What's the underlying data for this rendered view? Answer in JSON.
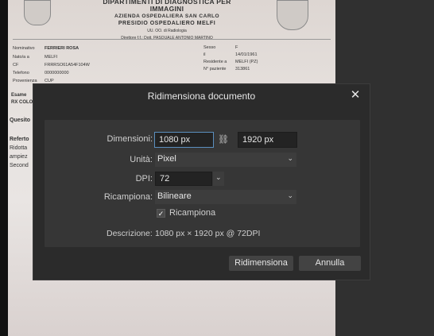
{
  "document": {
    "header": {
      "line1": "DIPARTIMENTI DI DIAGNOSTICA PER IMMAGINI",
      "line2": "AZIENDA OSPEDALIERA SAN CARLO",
      "line3": "PRESIDIO OSPEDALIERO MELFI",
      "line4": "UU. OO. di Radiologia",
      "line5": "Direttore f.f.: Dott.   PASQUALE ANTONIO MARTINO"
    },
    "patient": {
      "nominativo_label": "Nominativo",
      "nominativo_value": "FERRIERI ROSA",
      "nato_label": "Nato/a a",
      "nato_value": "MELFI",
      "cf_label": "CF",
      "cf_value": "FRRRSO61A54F104W",
      "telefono_label": "Telefono",
      "telefono_value": "0000000000",
      "provenienza_label": "Provenienza",
      "provenienza_value": "CUP",
      "sesso_label": "Sesso",
      "sesso_value": "F",
      "il_label": "il",
      "il_value": "14/01/1961",
      "residente_label": "Residente a",
      "residente_value": "MELFI (PZ)",
      "paziente_label": "N° paziente",
      "paziente_value": "313861"
    },
    "lower": {
      "esame": "Esame",
      "rx": "RX COLO",
      "quesito": "Quesito",
      "referto": "Referto",
      "ridotta": "Ridotta",
      "ampiez": "ampiez",
      "second": "Second"
    }
  },
  "dialog": {
    "title": "Ridimensiona documento",
    "close_glyph": "✕",
    "dimensioni_label": "Dimensioni:",
    "width_value": "1080 px",
    "height_value": "1920 px",
    "link_glyph": "⛓",
    "unita_label": "Unità:",
    "unita_value": "Pixel",
    "dpi_label": "DPI:",
    "dpi_value": "72",
    "ricampiona_label": "Ricampiona:",
    "ricampiona_value": "Bilineare",
    "ricampiona_check_label": "Ricampiona",
    "ricampiona_checked": true,
    "check_glyph": "✓",
    "descrizione_label": "Descrizione:",
    "descrizione_value": "1080 px × 1920 px @ 72DPI",
    "chevron_glyph": "⌄",
    "ok_label": "Ridimensiona",
    "cancel_label": "Annulla"
  }
}
